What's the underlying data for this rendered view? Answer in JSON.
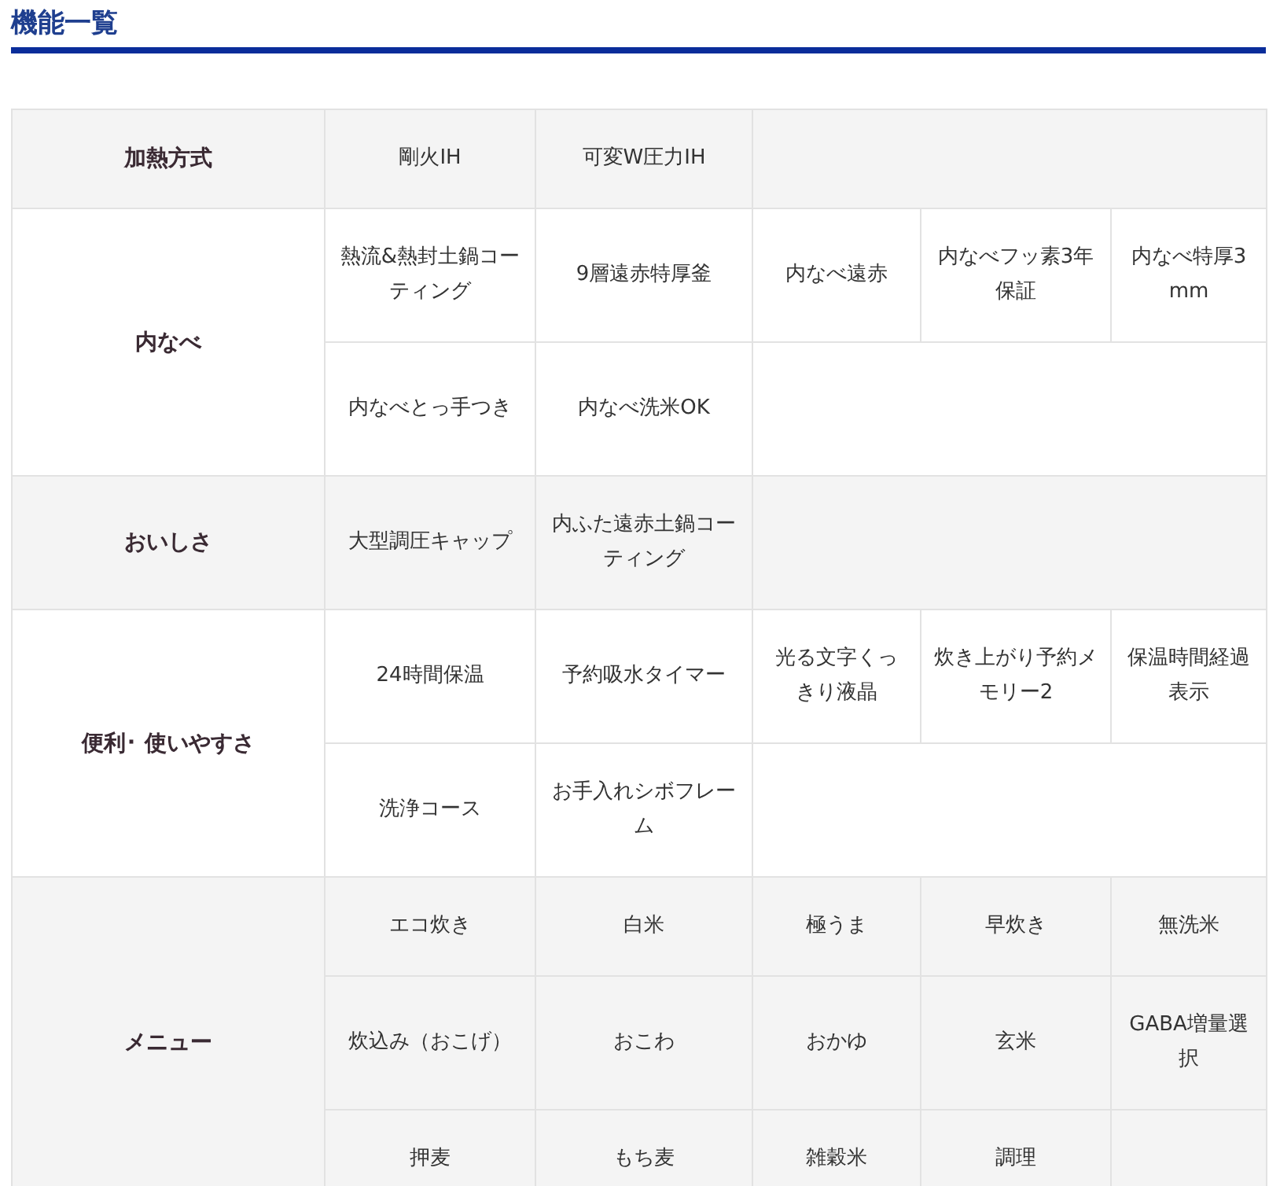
{
  "title": "機能一覧",
  "sections": [
    {
      "label": "加熱方式",
      "rows": [
        [
          "剛火IH",
          "可変W圧力IH"
        ]
      ]
    },
    {
      "label": "内なべ",
      "rows": [
        [
          "熱流&熱封土鍋コーティング",
          "9層遠赤特厚釜",
          "内なべ遠赤",
          "内なべフッ素3年保証",
          "内なべ特厚3mm"
        ],
        [
          "内なべとっ手つき",
          "内なべ洗米OK"
        ]
      ]
    },
    {
      "label": "おいしさ",
      "rows": [
        [
          "大型調圧キャップ",
          "内ふた遠赤土鍋コーティング"
        ]
      ]
    },
    {
      "label": "便利･ 使いやすさ",
      "rows": [
        [
          "24時間保温",
          "予約吸水タイマー",
          "光る文字くっきり液晶",
          "炊き上がり予約メモリー2",
          "保温時間経過表示"
        ],
        [
          "洗浄コース",
          "お手入れシボフレーム"
        ]
      ]
    },
    {
      "label": "メニュー",
      "rows": [
        [
          "エコ炊き",
          "白米",
          "極うま",
          "早炊き",
          "無洗米"
        ],
        [
          "炊込み（おこげ）",
          "おこわ",
          "おかゆ",
          "玄米",
          "GABA増量選択"
        ],
        [
          "押麦",
          "もち麦",
          "雑穀米",
          "調理"
        ]
      ]
    }
  ]
}
